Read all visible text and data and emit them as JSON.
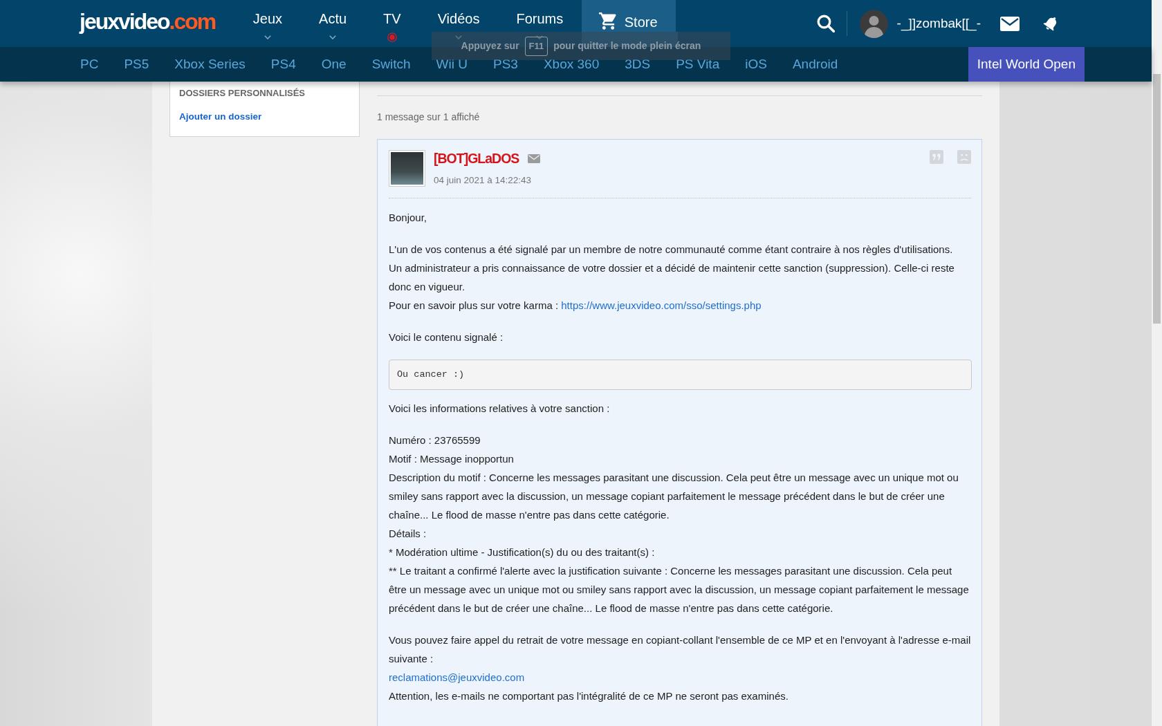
{
  "header": {
    "logo": {
      "text": "jeuxvideo",
      "accent": ".com"
    },
    "main_nav": [
      {
        "label": "Jeux",
        "kind": "dropdown"
      },
      {
        "label": "Actu",
        "kind": "dropdown"
      },
      {
        "label": "TV",
        "kind": "live"
      },
      {
        "label": "Vidéos",
        "kind": "dropdown"
      },
      {
        "label": "Forums",
        "kind": "dropdown"
      },
      {
        "label": "Store",
        "kind": "store"
      }
    ],
    "user": {
      "name": "-_]]zombak[[_-"
    },
    "platform_nav": [
      "PC",
      "PS5",
      "Xbox Series",
      "PS4",
      "One",
      "Switch",
      "Wii U",
      "PS3",
      "Xbox 360",
      "3DS",
      "PS Vita",
      "iOS",
      "Android"
    ],
    "promo": "Intel World Open"
  },
  "fullscreen_notice": {
    "before": "Appuyez sur",
    "key": "F11",
    "after": "pour quitter le mode plein écran"
  },
  "sidebar": {
    "title": "DOSSIERS PERSONNALISÉS",
    "link": "Ajouter un dossier"
  },
  "message_count": "1 message sur 1 affiché",
  "message": {
    "author": "[BOT]GLaDOS",
    "date": "04 juin 2021 à 14:22:43",
    "body": [
      {
        "kind": "text",
        "lines": [
          {
            "text": "Bonjour,"
          }
        ]
      },
      {
        "kind": "text",
        "lines": [
          {
            "text": "L'un de vos contenus a été signalé par un membre de notre communauté comme étant contraire à nos règles d'utilisations."
          },
          {
            "text": "Un administrateur a pris connaissance de votre dossier et a décidé de maintenir cette sanction (suppression). Celle-ci reste donc en vigueur."
          },
          {
            "text": "Pour en savoir plus sur votre karma :",
            "link": "https://www.jeuxvideo.com/sso/settings.php"
          }
        ]
      },
      {
        "kind": "text",
        "lines": [
          {
            "text": "Voici le contenu signalé :"
          }
        ]
      },
      {
        "kind": "code",
        "text": "Ou cancer :)"
      },
      {
        "kind": "text",
        "lines": [
          {
            "text": "Voici les informations relatives à votre sanction :"
          }
        ]
      },
      {
        "kind": "text",
        "lines": [
          {
            "text": "Numéro : 23765599"
          },
          {
            "text": "Motif : Message inopportun"
          },
          {
            "text": "Description du motif : Concerne les messages parasitant une discussion. Cela peut être un message avec un unique mot ou smiley sans rapport avec la discussion, un message copiant parfaitement le message précédent dans le but de créer une chaîne... Le flood de masse n'entre pas dans cette catégorie."
          },
          {
            "text": "Détails :"
          },
          {
            "text": "* Modération ultime - Justification(s) du ou des traitant(s) :"
          },
          {
            "text": "** Le traitant a confirmé l'alerte avec la justification suivante : Concerne les messages parasitant une discussion. Cela peut être un message avec un unique mot ou smiley sans rapport avec la discussion, un message copiant parfaitement le message précédent dans le but de créer une chaîne... Le flood de masse n'entre pas dans cette catégorie."
          }
        ]
      },
      {
        "kind": "text",
        "lines": [
          {
            "text": "Vous pouvez faire appel du retrait de votre message en copiant-collant l'ensemble de ce MP et en l'envoyant à l'adresse e-mail suivante :"
          },
          {
            "link": "reclamations@jeuxvideo.com"
          },
          {
            "text": "Attention, les e-mails ne comportant pas l'intégralité de ce MP ne seront pas examinés."
          }
        ]
      }
    ]
  }
}
